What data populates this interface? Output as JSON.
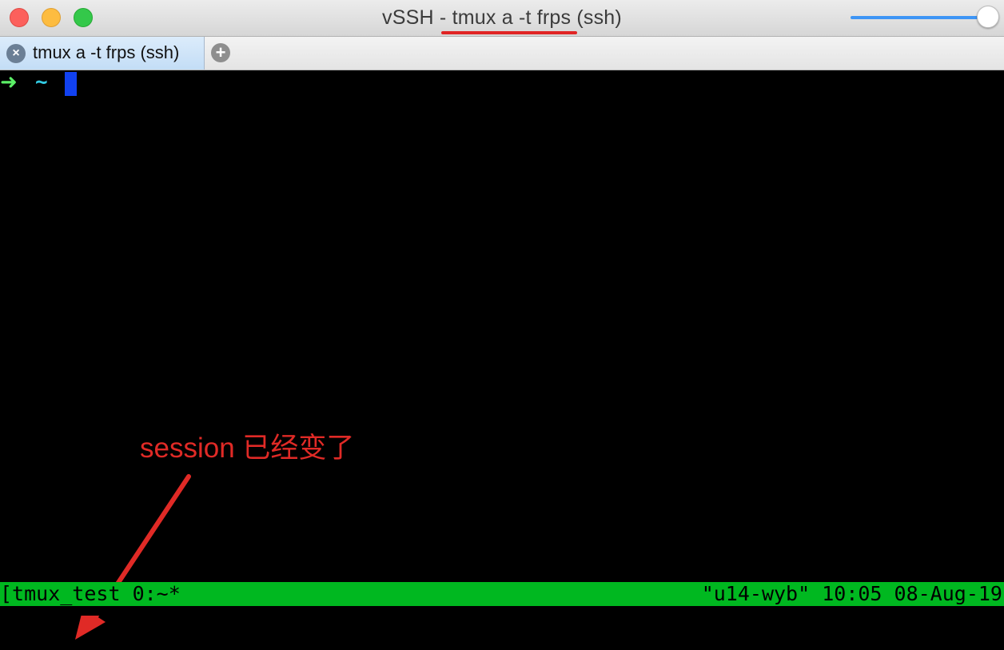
{
  "window": {
    "title": "vSSH - tmux a -t frps (ssh)",
    "accent_underline_color": "#e02424",
    "slider_color": "#3d95f5"
  },
  "tabs": [
    {
      "label": "tmux a -t frps (ssh)",
      "close_icon": "close-icon",
      "active": true
    }
  ],
  "new_tab_icon": "plus-icon",
  "terminal": {
    "prompt_arrow": "➜",
    "prompt_dir": "~",
    "cursor_color": "#1141f0"
  },
  "annotation": {
    "text": "session 已经变了",
    "color": "#e02a26"
  },
  "status_line": {
    "left": "[tmux_test 0:~*",
    "right": "\"u14-wyb\" 10:05 08-Aug-19",
    "background": "#00b820"
  }
}
